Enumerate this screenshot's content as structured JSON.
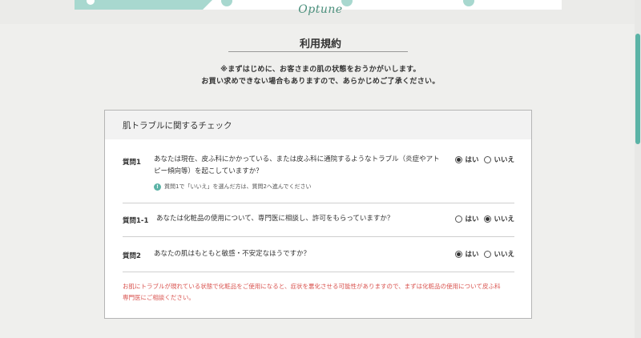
{
  "header": {
    "logo_text": "Optune"
  },
  "page": {
    "title": "利用規約",
    "notice_line1": "※まずはじめに、お客さまの肌の状態をおうかがいします。",
    "notice_line2": "お買い求めできない場合もありますので、あらかじめご了承ください。"
  },
  "card": {
    "header": "肌トラブルに関するチェック",
    "questions": [
      {
        "number": "質問1",
        "text_line1": "あなたは現在、皮ふ科にかかっている、または皮ふ科に通院するようなトラブル（炎症やアト",
        "text_line2": "ピー傾向等）を起こしていますか？",
        "note": "質問1で「いいえ」を選んだ方は、質問2へ進んでください",
        "yes_label": "はい",
        "no_label": "いいえ",
        "selected": "yes"
      },
      {
        "number": "質問1-1",
        "text_line1": "あなたは化粧品の使用について、専門医に相談し、許可をもらっていますか？",
        "yes_label": "はい",
        "no_label": "いいえ",
        "selected": "no"
      },
      {
        "number": "質問2",
        "text_line1": "あなたの肌はもともと敏感・不安定なほうですか？",
        "yes_label": "はい",
        "no_label": "いいえ",
        "selected": "yes"
      }
    ],
    "warning_line1": "お肌にトラブルが現れている状態で化粧品をご使用になると、症状を悪化させる可能性がありますので、まずは化粧品の使用について皮ふ科",
    "warning_line2": "専門医にご相談ください。",
    "note_icon_glyph": "!"
  },
  "colors": {
    "accent": "#5bb3a6",
    "step": "#a8d8cf",
    "warning": "#d9534f"
  },
  "icons": {
    "note": "info-circle-icon",
    "radio": "radio-icon"
  }
}
